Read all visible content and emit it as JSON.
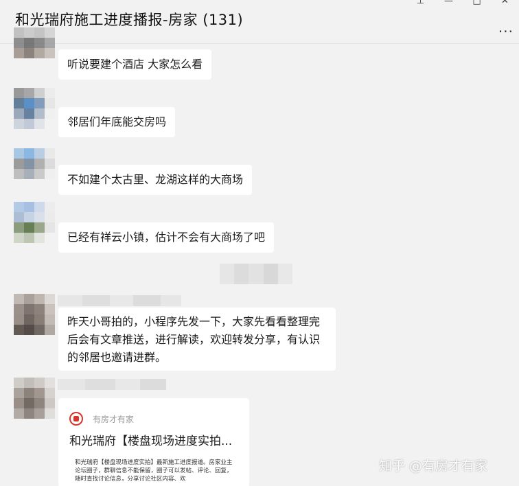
{
  "window": {
    "title": "和光瑞府施工进度播报-房家 (131)",
    "controls": [
      "pin-icon",
      "minimize-icon",
      "maximize-icon",
      "close-icon"
    ],
    "more_label": "..."
  },
  "messages": [
    {
      "text": "听说要建个酒店 大家怎么看"
    },
    {
      "text": "邻居们年底能交房吗"
    },
    {
      "text": "不如建个太古里、龙湖这样的大商场"
    },
    {
      "text": "已经有祥云小镇，估计不会有大商场了吧"
    },
    {
      "text": "昨天小哥拍的，小程序先发一下，大家先看看整理完后会有文章推送，进行解读，欢迎转发分享，有认识的邻居也邀请进群。"
    }
  ],
  "card": {
    "source": "有房才有家",
    "title": "和光瑞府【楼盘现场进度实拍...",
    "body": "和光瑞府【楼盘现场进度实拍】最新施工进度报道。房家业主论坛圈子，群聊信息不能保留，圈子可以发帖、评论、回复，随时查找讨论信息，分享讨论社区内容、欢"
  },
  "watermark": "知乎 @有房才有家",
  "colors": {
    "background": "#f2f2f2",
    "bubble": "#ffffff",
    "card_logo": "#d9362b"
  }
}
